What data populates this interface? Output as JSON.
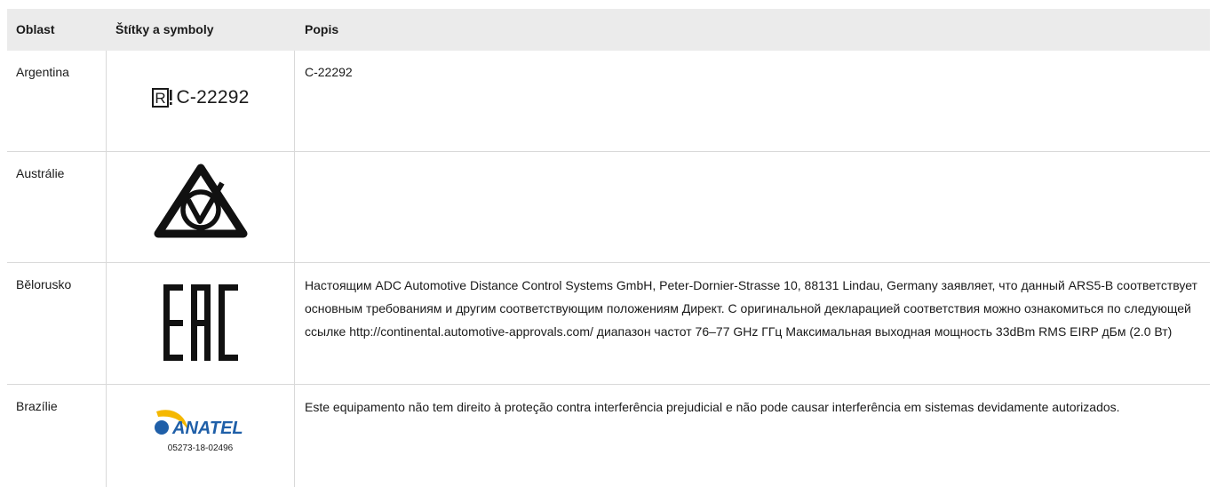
{
  "headers": {
    "region": "Oblast",
    "labels": "Štítky a symboly",
    "description": "Popis"
  },
  "rows": [
    {
      "region": "Argentina",
      "symbol": "argentina-r-mark",
      "symbol_text": "C-22292",
      "description": "C-22292"
    },
    {
      "region": "Austrálie",
      "symbol": "rcm-mark",
      "description": ""
    },
    {
      "region": "Bělorusko",
      "symbol": "eac-mark",
      "description": "Настоящим ADC Automotive Distance Control Systems GmbH, Peter-Dornier-Strasse 10, 88131 Lindau, Germany заявляет, что данный ARS5-B соответствует основным требованиям и другим соответствующим положениям Директ. С оригинальной декларацией соответствия можно ознакомиться по следующей ссылке http://continental.automotive-approvals.com/ диапазон частот 76–77 GHz ГГц Максимальная выходная мощность 33dBm RMS EIRP дБм (2.0 Вт)"
    },
    {
      "region": "Brazílie",
      "symbol": "anatel-logo",
      "symbol_text": "05273-18-02496",
      "logo_text": "ANATEL",
      "description": "Este equipamento não tem direito à proteção contra interferência prejudicial e não pode causar interferência em sistemas devidamente autorizados."
    }
  ],
  "colors": {
    "header_bg": "#ebebeb",
    "border": "#d9d9d9",
    "anatel_blue": "#1f5fa8",
    "anatel_yellow": "#f5b800"
  }
}
